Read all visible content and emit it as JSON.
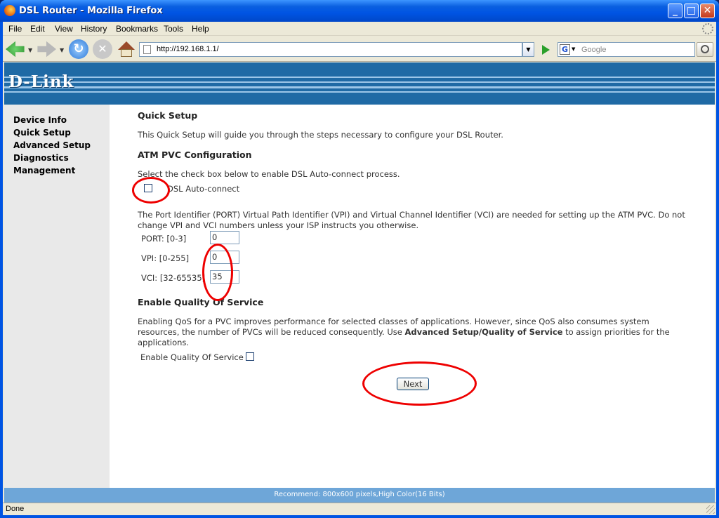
{
  "window": {
    "title": "DSL Router - Mozilla Firefox"
  },
  "menubar": [
    "File",
    "Edit",
    "View",
    "History",
    "Bookmarks",
    "Tools",
    "Help"
  ],
  "navbar": {
    "url": "http://192.168.1.1/",
    "search_placeholder": "Google"
  },
  "banner": {
    "logo_text": "D-Link"
  },
  "sidebar": {
    "items": [
      "Device Info",
      "Quick Setup",
      "Advanced Setup",
      "Diagnostics",
      "Management"
    ]
  },
  "main": {
    "title": "Quick Setup",
    "intro": "This Quick Setup will guide you through the steps necessary to configure your DSL Router.",
    "atm_heading": "ATM PVC Configuration",
    "autoconnect_instruction": "Select the check box below to enable DSL Auto-connect process.",
    "autoconnect_label": "DSL Auto-connect",
    "autoconnect_checked": false,
    "pvc_note": "The Port Identifier (PORT) Virtual Path Identifier (VPI) and Virtual Channel Identifier (VCI) are needed for setting up the ATM PVC. Do not change VPI and VCI numbers unless your ISP instructs you otherwise.",
    "port_label": "PORT: [0-3]",
    "port_value": "0",
    "vpi_label": "VPI: [0-255]",
    "vpi_value": "0",
    "vci_label": "VCI: [32-65535]",
    "vci_value": "35",
    "qos_heading": "Enable Quality Of Service",
    "qos_note_1": "Enabling QoS for a PVC improves performance for selected classes of applications. However, since QoS also consumes system resources, the number of PVCs will be reduced consequently. Use ",
    "qos_note_link": "Advanced Setup/Quality of Service",
    "qos_note_2": " to assign priorities for the applications.",
    "qos_label": "Enable Quality Of Service",
    "qos_checked": false,
    "next_label": "Next"
  },
  "recommend": "Recommend: 800x600 pixels,High Color(16 Bits)",
  "status": {
    "text": "Done"
  },
  "colors": {
    "banner": "#1f6aa5",
    "annotation_ring": "#ee0000",
    "sidebar": "#e9e9e9"
  }
}
